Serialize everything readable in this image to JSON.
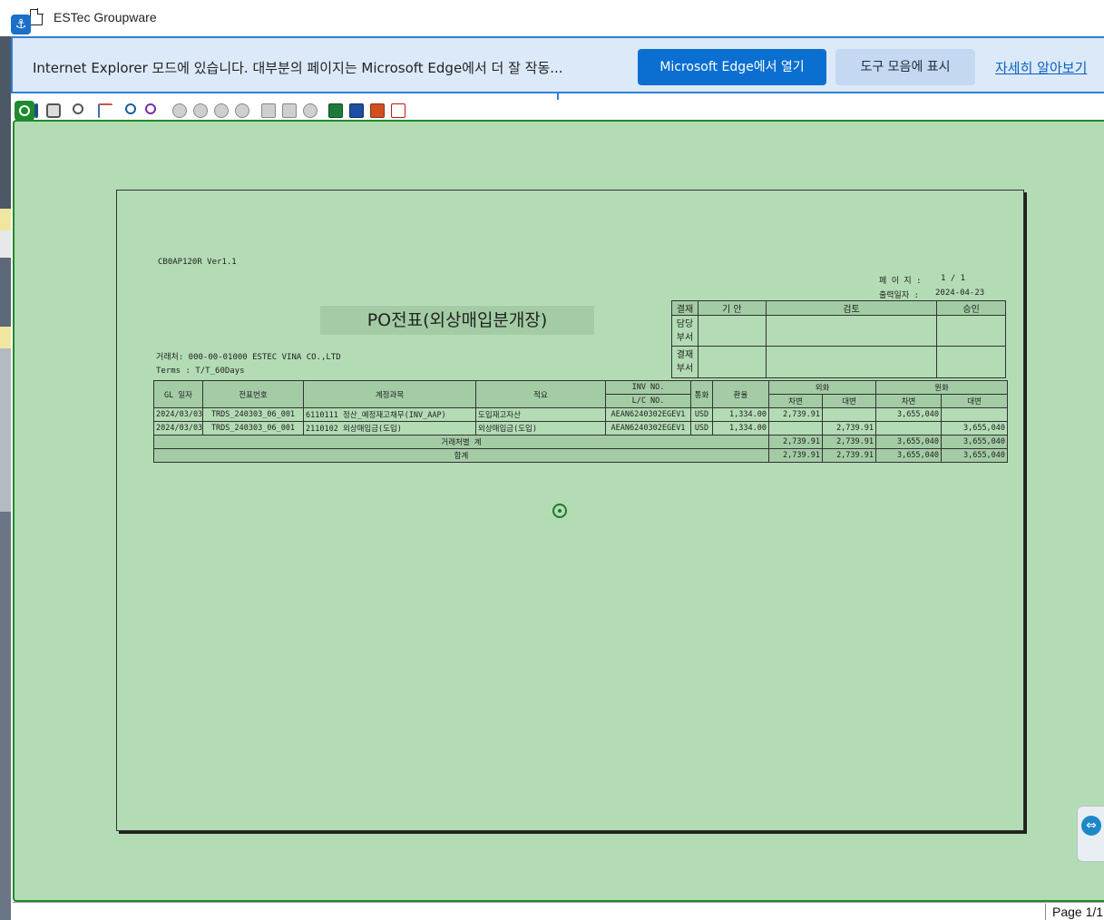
{
  "window": {
    "title": "ESTec Groupware"
  },
  "ie_bar": {
    "message": "Internet Explorer 모드에 있습니다. 대부분의 페이지는 Microsoft Edge에서 더 잘 작동...",
    "open_edge_label": "Microsoft Edge에서 열기",
    "show_toolbar_label": "도구 모음에 표시",
    "learn_more_label": "자세히 알아보기"
  },
  "toolbar": {
    "icons": [
      "target-icon",
      "save-icon",
      "print-icon",
      "zoom-icon",
      "tree-icon",
      "find-icon",
      "find-next-icon",
      "first-page-icon",
      "prev-page-icon",
      "next-page-icon",
      "last-page-icon",
      "page-back-icon",
      "page-forward-icon",
      "stop-icon",
      "excel-icon",
      "word-icon",
      "powerpoint-icon",
      "pdf-icon"
    ]
  },
  "report": {
    "code": "CB0AP120R Ver1.1",
    "page_label": "페 이 지 :",
    "page_value": "1 / 1",
    "print_date_label": "출력일자 :",
    "print_date_value": "2024-04-23",
    "title": "PO전표(외상매입분개장)",
    "vendor": "거래처: 000-00-01000 ESTEC VINA CO.,LTD",
    "terms": "Terms : T/T_60Days",
    "approval": {
      "col0": "결재",
      "col1": "기 안",
      "col2": "검토",
      "col3": "승인",
      "row1": "담당\n부서",
      "row2": "결재\n부서"
    },
    "columns": {
      "gl_date": "GL 일자",
      "voucher_no": "전표번호",
      "account": "계정과목",
      "description": "적요",
      "inv_no": "INV NO.",
      "lc_no": "L/C NO.",
      "currency": "통화",
      "rate": "환율",
      "foreign": "외화",
      "local": "원화",
      "debit": "차변",
      "credit": "대변"
    },
    "rows": [
      {
        "gl_date": "2024/03/03",
        "voucher_no": "TRDS_240303_06_001",
        "account": "6110111 정산_예정재고채무(INV_AAP)",
        "description": "도입재고자산",
        "inv_no": "AEAN6240302EGEV1",
        "currency": "USD",
        "rate": "1,334.00",
        "fx_debit": "2,739.91",
        "fx_credit": "",
        "krw_debit": "3,655,040",
        "krw_credit": ""
      },
      {
        "gl_date": "2024/03/03",
        "voucher_no": "TRDS_240303_06_001",
        "account": "2110102 외상매입금(도입)",
        "description": "외상매입금(도입)",
        "inv_no": "AEAN6240302EGEV1",
        "currency": "USD",
        "rate": "1,334.00",
        "fx_debit": "",
        "fx_credit": "2,739.91",
        "krw_debit": "",
        "krw_credit": "3,655,040"
      }
    ],
    "subtotal": {
      "label": "거래처별 계",
      "fx_debit": "2,739.91",
      "fx_credit": "2,739.91",
      "krw_debit": "3,655,040",
      "krw_credit": "3,655,040"
    },
    "total": {
      "label": "합계",
      "fx_debit": "2,739.91",
      "fx_credit": "2,739.91",
      "krw_debit": "3,655,040",
      "krw_credit": "3,655,040"
    }
  },
  "status": {
    "page_indicator": "Page 1/1"
  }
}
